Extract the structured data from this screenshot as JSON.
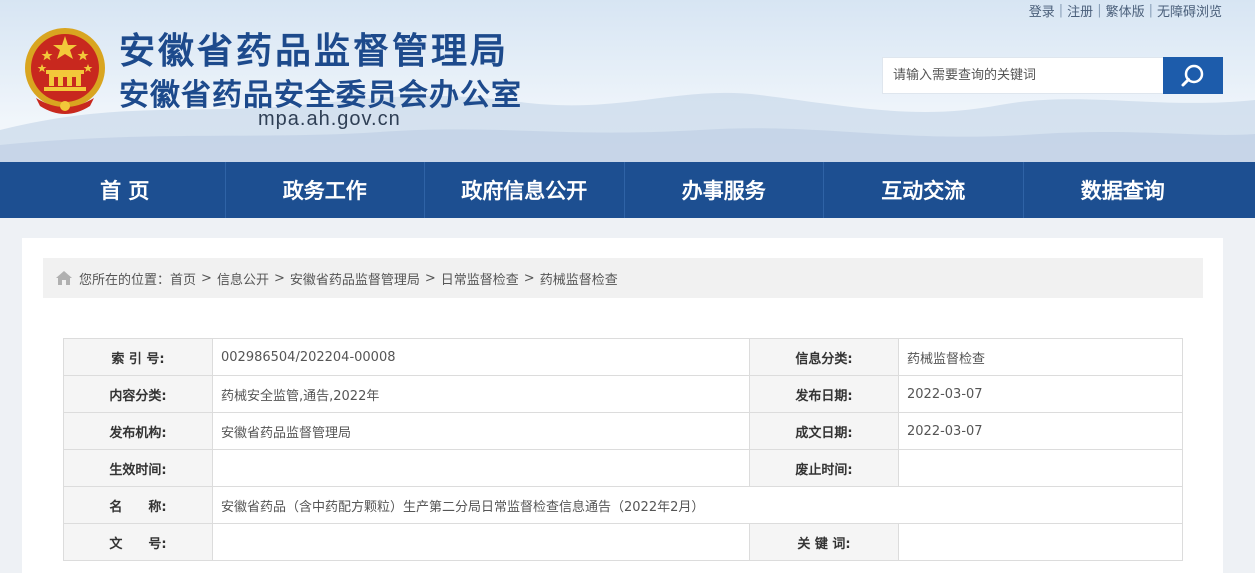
{
  "header": {
    "top_links": [
      "登录",
      "注册",
      "繁体版",
      "无障碍浏览"
    ],
    "title_main": "安徽省药品监督管理局",
    "title_sub": "安徽省药品安全委员会办公室",
    "domain": "mpa.ah.gov.cn",
    "search_placeholder": "请输入需要查询的关键词",
    "search_icon": "search-icon"
  },
  "nav": {
    "items": [
      "首 页",
      "政务工作",
      "政府信息公开",
      "办事服务",
      "互动交流",
      "数据查询"
    ]
  },
  "breadcrumb": {
    "prefix": "您所在的位置：",
    "items": [
      "首页",
      "信息公开",
      "安徽省药品监督管理局",
      "日常监督检查",
      "药械监督检查"
    ],
    "separator": ">"
  },
  "info": {
    "index_label": "索 引 号:",
    "index_value": "002986504/202204-00008",
    "category_label": "信息分类:",
    "category_value": "药械监督检查",
    "content_type_label": "内容分类:",
    "content_type_value": "药械安全监管,通告,2022年",
    "publish_date_label": "发布日期:",
    "publish_date_value": "2022-03-07",
    "publisher_label": "发布机构:",
    "publisher_value": "安徽省药品监督管理局",
    "doc_date_label": "成文日期:",
    "doc_date_value": "2022-03-07",
    "effective_label": "生效时间:",
    "effective_value": "",
    "expire_label": "废止时间:",
    "expire_value": "",
    "name_label": "名　　称:",
    "name_value": "安徽省药品（含中药配方颗粒）生产第二分局日常监督检查信息通告（2022年2月）",
    "doc_no_label": "文　　号:",
    "doc_no_value": "",
    "keywords_label": "关 键 词:",
    "keywords_value": ""
  },
  "colors": {
    "brand_blue": "#1d4f91",
    "title_blue": "#1d4a8c",
    "search_button": "#1d5cab"
  }
}
